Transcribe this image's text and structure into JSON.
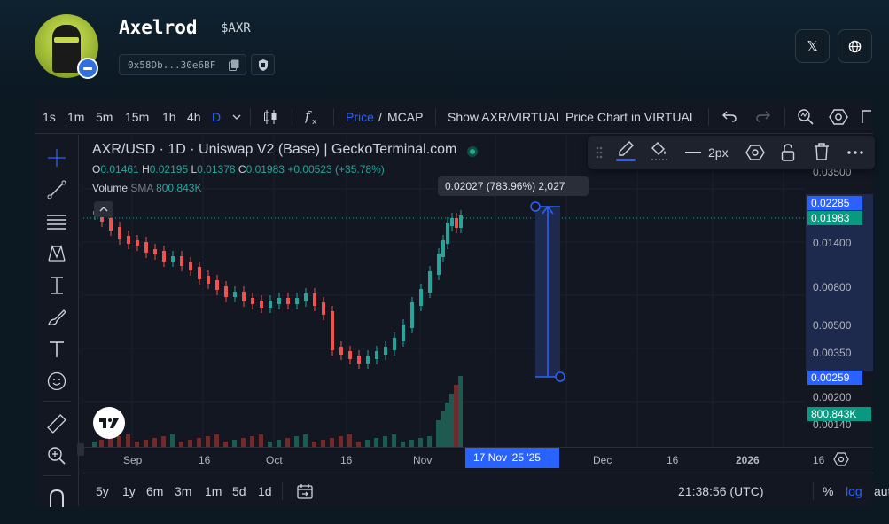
{
  "header": {
    "token_name": "Axelrod",
    "ticker": "$AXR",
    "address": "0x58Db...30e6BF",
    "x_button": "𝕏"
  },
  "toolbar": {
    "intervals": [
      "1s",
      "1m",
      "5m",
      "15m",
      "1h",
      "4h",
      "D"
    ],
    "active_interval": "D",
    "price_label": "Price",
    "separator": "/",
    "mcap_label": "MCAP",
    "pair_chart_label": "Show AXR/VIRTUAL Price Chart in VIRTUAL"
  },
  "legend": {
    "title": "AXR/USD · 1D · Uniswap V2 (Base) | GeckoTerminal.com",
    "o_label": "O",
    "o_value": "0.01461",
    "h_label": "H",
    "h_value": "0.02195",
    "l_label": "L",
    "l_value": "0.01378",
    "c_label": "C",
    "c_value": "0.01983",
    "change": "+0.00523 (+35.78%)",
    "volume_label": "Volume",
    "sma_label": "SMA",
    "volume_value": "800.843K"
  },
  "drawing_toolbar": {
    "width_label": "2px"
  },
  "measure_tooltip": "0.02027 (783.96%) 2,027",
  "price_scale": {
    "labels": [
      "0.03500",
      "0.01400",
      "0.00800",
      "0.00500",
      "0.00350",
      "0.00200",
      "0.00140"
    ],
    "tag_top": "0.02285",
    "tag_last": "0.01983",
    "tag_bottom": "0.00259",
    "tag_volume": "800.843K",
    "colors": {
      "tag_blue": "#2962ff",
      "tag_green": "#089981"
    }
  },
  "time_axis": {
    "labels": [
      "Sep",
      "16",
      "Oct",
      "16",
      "Nov",
      "Dec",
      "16",
      "2026",
      "16"
    ],
    "highlight": "17 Nov '25",
    "highlight_suffix": "'25"
  },
  "bottom_bar": {
    "ranges": [
      "5y",
      "1y",
      "6m",
      "3m",
      "1m",
      "5d",
      "1d"
    ],
    "clock": "21:38:56 (UTC)",
    "percent": "%",
    "log": "log",
    "auto": "auto"
  },
  "chart_data": {
    "type": "candlestick",
    "series": [
      {
        "name": "AXR/USD",
        "type": "candlestick"
      },
      {
        "name": "Volume",
        "type": "bar"
      }
    ],
    "last": {
      "open": 0.01461,
      "high": 0.02195,
      "low": 0.01378,
      "close": 0.01983
    },
    "volume_last": "800.843K",
    "y_scale": "log",
    "colors": {
      "up": "#26a69a",
      "down": "#ef5350"
    }
  }
}
